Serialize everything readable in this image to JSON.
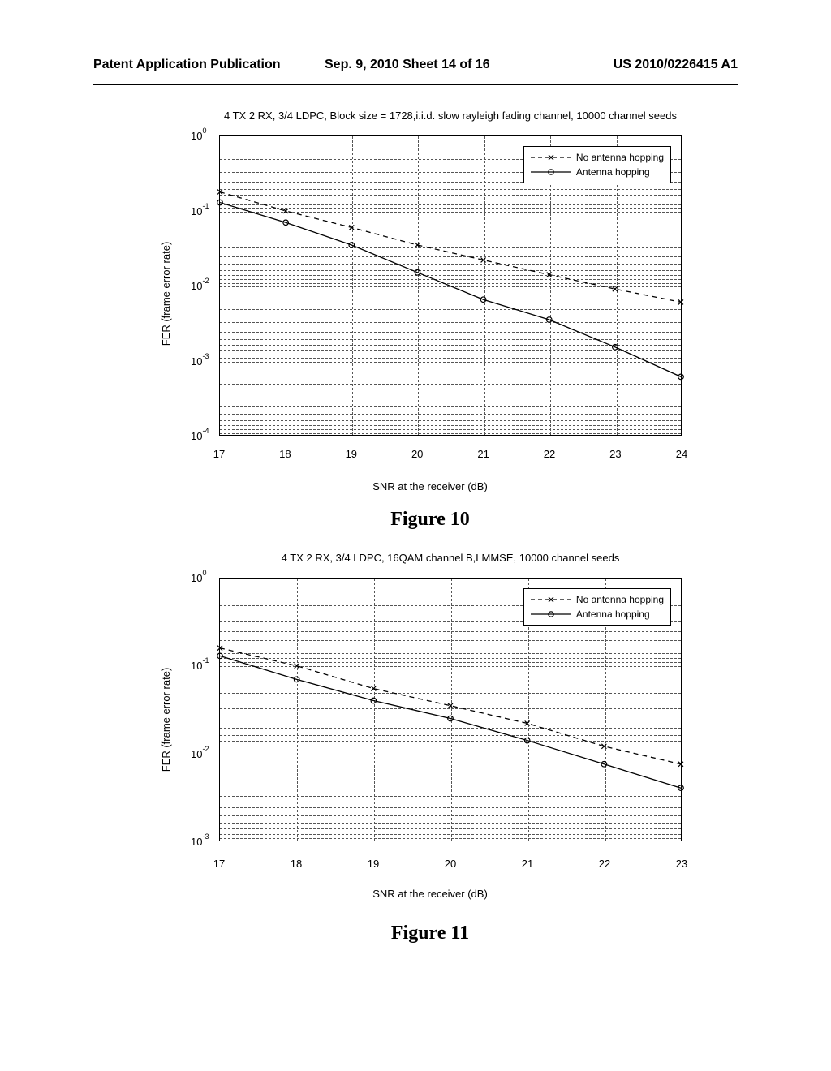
{
  "header": {
    "left": "Patent Application Publication",
    "center": "Sep. 9, 2010  Sheet 14 of 16",
    "right": "US 2010/0226415 A1"
  },
  "charts": [
    {
      "title": "4 TX 2 RX, 3/4 LDPC, Block size = 1728,i.i.d. slow rayleigh fading channel, 10000 channel seeds",
      "ylabel": "FER (frame error rate)",
      "xlabel": "SNR at the receiver (dB)",
      "figure_caption": "Figure 10",
      "yticks_html": [
        "10<sup>0</sup>",
        "10<sup>-1</sup>",
        "10<sup>-2</sup>",
        "10<sup>-3</sup>",
        "10<sup>-4</sup>"
      ],
      "xticks": [
        "17",
        "18",
        "19",
        "20",
        "21",
        "22",
        "23",
        "24"
      ],
      "legend": {
        "items": [
          "No antenna hopping",
          "Antenna hopping"
        ]
      }
    },
    {
      "title": "4 TX 2 RX, 3/4 LDPC, 16QAM channel B,LMMSE, 10000 channel seeds",
      "ylabel": "FER (frame error rate)",
      "xlabel": "SNR at the receiver (dB)",
      "figure_caption": "Figure 11",
      "yticks_html": [
        "10<sup>0</sup>",
        "10<sup>-1</sup>",
        "10<sup>-2</sup>",
        "10<sup>-3</sup>"
      ],
      "xticks": [
        "17",
        "18",
        "19",
        "20",
        "21",
        "22",
        "23"
      ],
      "legend": {
        "items": [
          "No antenna hopping",
          "Antenna hopping"
        ]
      }
    }
  ],
  "chart_data": [
    {
      "type": "line",
      "title": "4 TX 2 RX, 3/4 LDPC, Block size = 1728,i.i.d. slow rayleigh fading channel, 10000 channel seeds",
      "xlabel": "SNR at the receiver (dB)",
      "ylabel": "FER (frame error rate)",
      "xlim": [
        17,
        24
      ],
      "ylim": [
        0.0001,
        1
      ],
      "yscale": "log",
      "series": [
        {
          "name": "No antenna hopping",
          "marker": "x",
          "line": "dash",
          "x": [
            17,
            18,
            19,
            20,
            21,
            22,
            23,
            24
          ],
          "y": [
            0.18,
            0.1,
            0.06,
            0.035,
            0.022,
            0.014,
            0.009,
            0.006
          ]
        },
        {
          "name": "Antenna hopping",
          "marker": "o",
          "line": "solid",
          "x": [
            17,
            18,
            19,
            20,
            21,
            22,
            23,
            24
          ],
          "y": [
            0.13,
            0.07,
            0.035,
            0.015,
            0.0065,
            0.0035,
            0.0015,
            0.0006
          ]
        }
      ],
      "grid": true,
      "legend_position": "top-right"
    },
    {
      "type": "line",
      "title": "4 TX 2 RX, 3/4 LDPC, 16QAM channel B,LMMSE, 10000 channel seeds",
      "xlabel": "SNR at the receiver (dB)",
      "ylabel": "FER (frame error rate)",
      "xlim": [
        17,
        23
      ],
      "ylim": [
        0.001,
        1
      ],
      "yscale": "log",
      "series": [
        {
          "name": "No antenna hopping",
          "marker": "x",
          "line": "dash",
          "x": [
            17,
            18,
            19,
            20,
            21,
            22,
            23
          ],
          "y": [
            0.16,
            0.1,
            0.055,
            0.035,
            0.022,
            0.012,
            0.0075
          ]
        },
        {
          "name": "Antenna hopping",
          "marker": "o",
          "line": "solid",
          "x": [
            17,
            18,
            19,
            20,
            21,
            22,
            23
          ],
          "y": [
            0.13,
            0.07,
            0.04,
            0.025,
            0.014,
            0.0075,
            0.004
          ]
        }
      ],
      "grid": true,
      "legend_position": "top-right"
    }
  ]
}
